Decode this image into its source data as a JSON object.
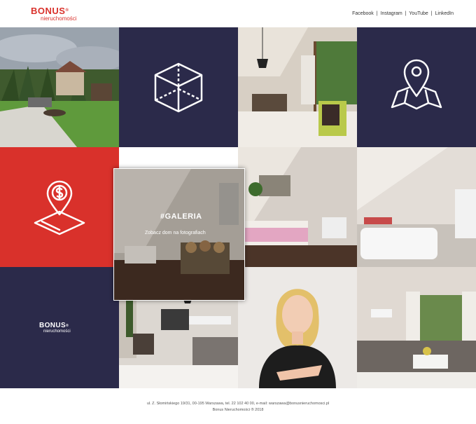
{
  "header": {
    "logo_main": "BONUS",
    "logo_reg": "®",
    "logo_sub": "nieruchomości",
    "social": [
      "Facebook",
      "Instagram",
      "YouTube",
      "LinkedIn"
    ],
    "social_sep": "|"
  },
  "gallery": {
    "title": "#GALERIA",
    "subtitle": "Zobacz dom na fotografiach"
  },
  "tiles": {
    "box_icon": "cube-3d-icon",
    "map_pin_icon": "map-pin-icon",
    "price_pin_icon": "price-location-icon"
  },
  "small_logo": {
    "main": "BONUS",
    "reg": "®",
    "sub": "nieruchomości"
  },
  "footer": {
    "line1": "ul. Z. Słomińskiego 19/31, 00-195 Warszawa, tel. 22 102 40 00, e-mail: warszawa@bonusnieruchomosci.pl",
    "line2": "Bonus Nieruchomości ® 2018"
  },
  "colors": {
    "brand_red": "#d9312b",
    "navy": "#2b2a4a"
  }
}
